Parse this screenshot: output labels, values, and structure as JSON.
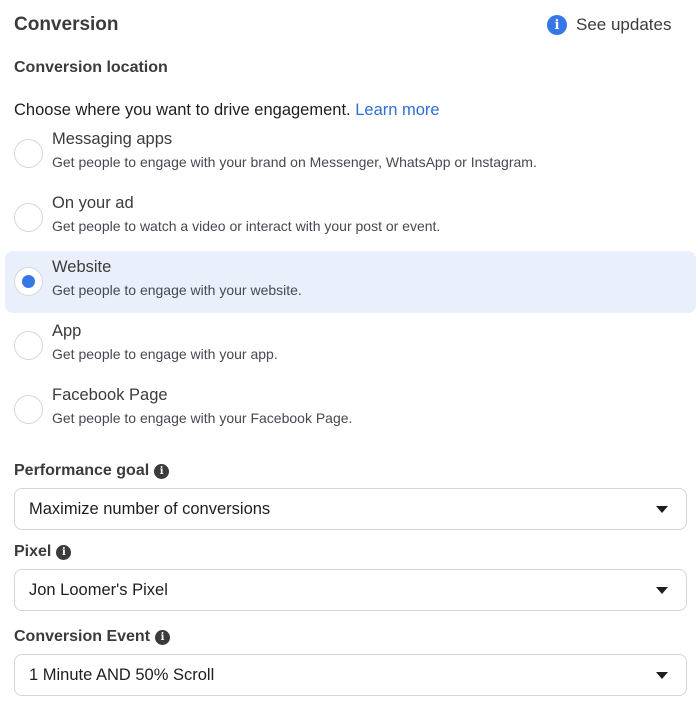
{
  "header": {
    "title": "Conversion",
    "see_updates_label": "See updates",
    "see_updates_icon": "info-icon"
  },
  "conversion_location": {
    "heading": "Conversion location",
    "intro_text": "Choose where you want to drive engagement. ",
    "learn_more_label": "Learn more",
    "selected": "Website",
    "options": [
      {
        "label": "Messaging apps",
        "description": "Get people to engage with your brand on Messenger, WhatsApp or Instagram."
      },
      {
        "label": "On your ad",
        "description": "Get people to watch a video or interact with your post or event."
      },
      {
        "label": "Website",
        "description": "Get people to engage with your website."
      },
      {
        "label": "App",
        "description": "Get people to engage with your app."
      },
      {
        "label": "Facebook Page",
        "description": "Get people to engage with your Facebook Page."
      }
    ]
  },
  "fields": {
    "performance_goal": {
      "label": "Performance goal",
      "value": "Maximize number of conversions"
    },
    "pixel": {
      "label": "Pixel",
      "value": "Jon Loomer's Pixel"
    },
    "conversion_event": {
      "label": "Conversion Event",
      "value": "1 Minute AND 50% Scroll"
    }
  },
  "colors": {
    "accent": "#3578e5",
    "link": "#2e6fd8",
    "selected_bg": "#eaf0fb"
  }
}
